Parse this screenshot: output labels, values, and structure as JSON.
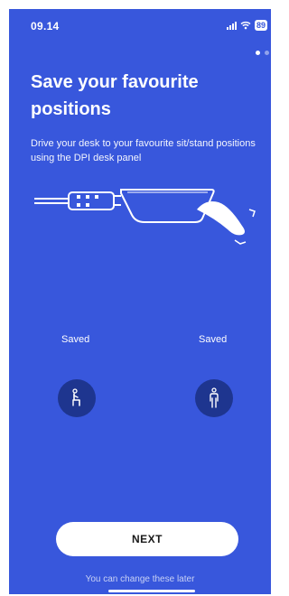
{
  "status": {
    "time": "09.14",
    "battery": "89"
  },
  "onboarding": {
    "title": "Save your favourite positions",
    "subtitle": "Drive your desk to your favourite sit/stand positions using the DPI desk panel",
    "positions": [
      {
        "label": "Saved",
        "icon": "sitting-person-icon"
      },
      {
        "label": "Saved",
        "icon": "standing-person-icon"
      }
    ],
    "next_label": "NEXT",
    "hint": "You can change these later"
  },
  "colors": {
    "background": "#3857dc",
    "button_circle": "#1e358f",
    "next_button": "#ffffff"
  }
}
